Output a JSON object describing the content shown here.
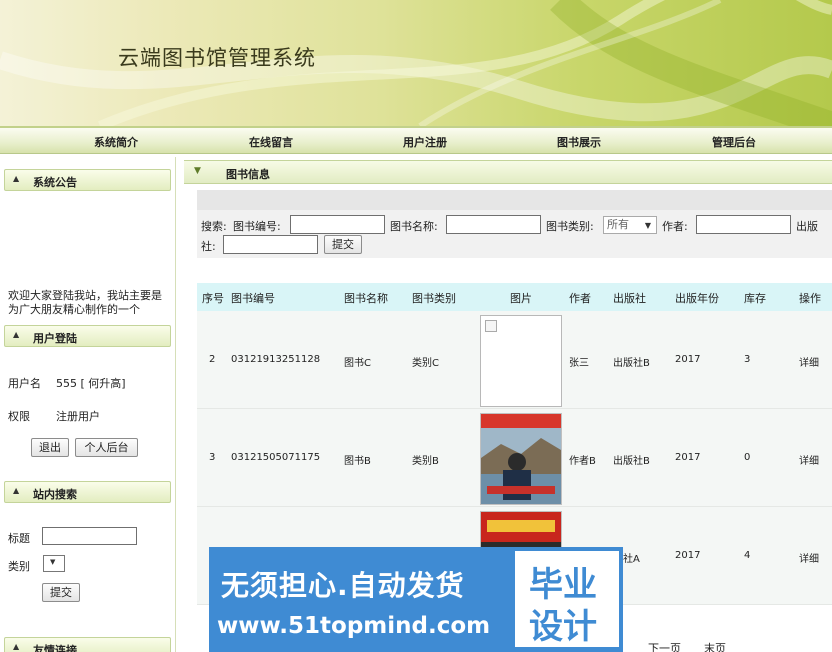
{
  "app": {
    "title": "云端图书馆管理系统"
  },
  "nav": [
    "系统简介",
    "在线留言",
    "用户注册",
    "图书展示",
    "管理后台"
  ],
  "sidebar": {
    "notice_title": "系统公告",
    "notice_text": "欢迎大家登陆我站，我站主要是为广大朋友精心制作的一个",
    "login_title": "用户登陆",
    "user_label": "用户名",
    "user_value": "555 [ 何升高]",
    "role_label": "权限",
    "role_value": "注册用户",
    "logout_btn": "退出",
    "personal_btn": "个人后台",
    "search_title": "站内搜索",
    "search_field_label": "标题",
    "search_type_label": "类别",
    "search_submit": "提交",
    "links_title": "友情连接"
  },
  "main": {
    "title": "图书信息",
    "search": {
      "prefix": "搜索:",
      "book_no_label": "图书编号:",
      "book_name_label": "图书名称:",
      "category_label": "图书类别:",
      "category_value": "所有",
      "author_label": "作者:",
      "publisher_label_1": "出版",
      "publisher_label_2": "社:",
      "submit": "提交"
    },
    "table": {
      "columns": [
        "序号",
        "图书编号",
        "图书名称",
        "图书类别",
        "图片",
        "作者",
        "出版社",
        "出版年份",
        "库存",
        "操作"
      ],
      "rows": [
        {
          "index": "2",
          "book_no": "03121913251128",
          "name": "图书C",
          "category": "类别C",
          "author": "张三",
          "publisher": "出版社B",
          "year": "2017",
          "stock": "3",
          "action": "详细"
        },
        {
          "index": "3",
          "book_no": "03121505071175",
          "name": "图书B",
          "category": "类别B",
          "author": "作者B",
          "publisher": "出版社B",
          "year": "2017",
          "stock": "0",
          "action": "详细"
        },
        {
          "index": "",
          "book_no": "",
          "name": "",
          "category": "",
          "author": "",
          "publisher": "版社A",
          "year": "2017",
          "stock": "4",
          "action": "详细"
        }
      ]
    },
    "pager": {
      "next": "下一页",
      "last": "末页"
    }
  },
  "watermark": {
    "line1": "无须担心.自动发货",
    "line2": "www.51topmind.com",
    "box1": "毕业",
    "box2": "设计"
  }
}
